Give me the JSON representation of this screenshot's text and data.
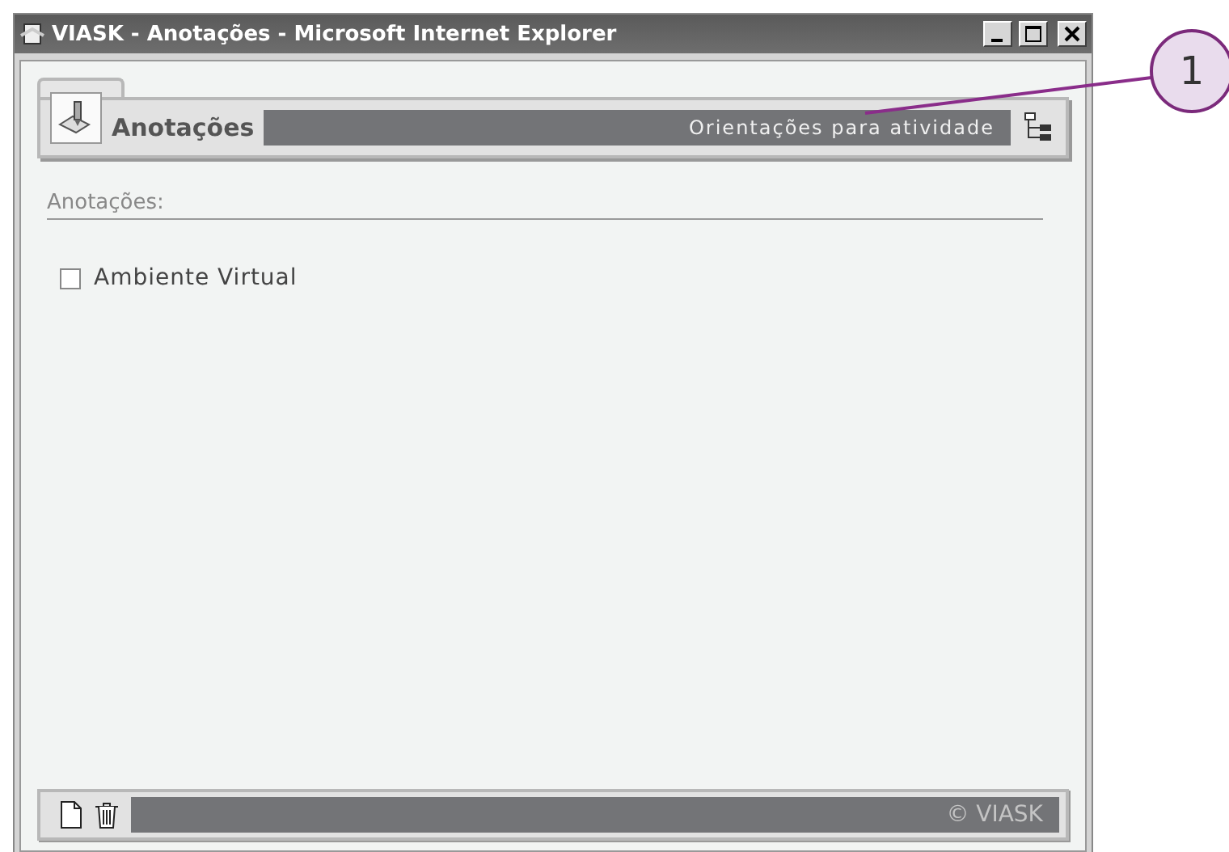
{
  "window": {
    "title": "VIASK - Anotações - Microsoft Internet Explorer"
  },
  "header": {
    "title": "Anotações",
    "subtitle": "Orientações para atividade"
  },
  "section": {
    "label": "Anotações:"
  },
  "items": [
    {
      "label": "Ambiente Virtual",
      "checked": false
    }
  ],
  "footer": {
    "brand": "© VIASK"
  },
  "callout": {
    "label": "1"
  }
}
